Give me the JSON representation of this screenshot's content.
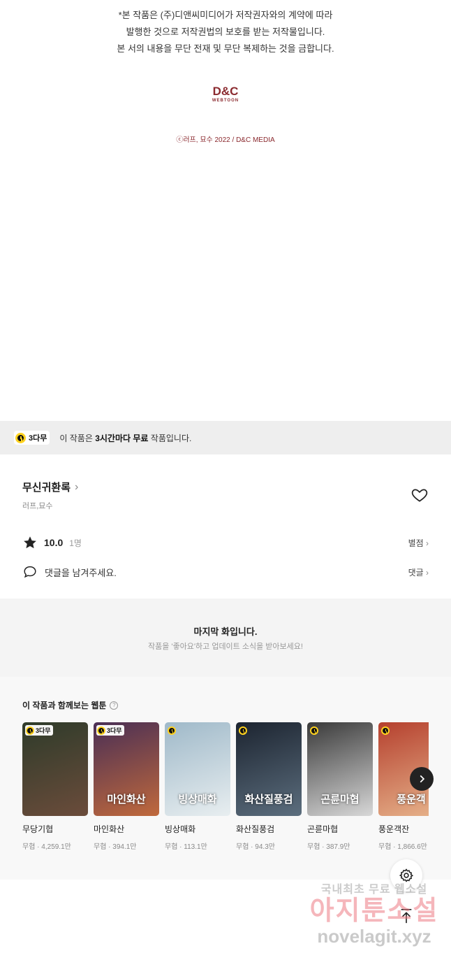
{
  "notice": {
    "line1": "*본 작품은 (주)디앤씨미디어가 저작권자와의 계약에 따라",
    "line2": "발행한 것으로 저작권법의 보호를 받는 저작물입니다.",
    "line3": "본 서의 내용을 무단 전재 및 무단 복제하는 것을 금합니다."
  },
  "logo": {
    "main": "D&C",
    "sub": "WEBTOON"
  },
  "copyright": "ⓒ러프, 묘수 2022 / D&C MEDIA",
  "free_bar": {
    "badge": "3다무",
    "text_prefix": "이 작품은 ",
    "text_bold": "3시간마다 무료",
    "text_suffix": " 작품입니다."
  },
  "work": {
    "title": "무신귀환록",
    "authors": "러프,묘수",
    "rating": "10.0",
    "rating_count": "1명",
    "rating_link": "별점",
    "comment_placeholder": "댓글을 남겨주세요.",
    "comment_link": "댓글"
  },
  "last_episode": {
    "title": "마지막 화입니다.",
    "subtitle": "작품을 '좋아요'하고 업데이트 소식을 받아보세요!"
  },
  "recommendations": {
    "heading": "이 작품과 함께보는 웹툰",
    "items": [
      {
        "name": "무당기협",
        "meta": "무협 · 4,259.1만",
        "badge": "3다무",
        "art": "",
        "color1": "#2e3b2a",
        "color2": "#6b4c3b"
      },
      {
        "name": "마인화산",
        "meta": "무협 · 394.1만",
        "badge": "3다무",
        "art": "마인화산",
        "color1": "#4a2f55",
        "color2": "#c0693c"
      },
      {
        "name": "빙상매화",
        "meta": "무협 · 113.1만",
        "badge": "",
        "art": "빙상매화",
        "color1": "#9fb9c9",
        "color2": "#e8eef0"
      },
      {
        "name": "화산질풍검",
        "meta": "무협 · 94.3만",
        "badge": "",
        "art": "화산질풍검",
        "color1": "#1c2430",
        "color2": "#5c6e7e"
      },
      {
        "name": "곤륜마협",
        "meta": "무협 · 387.9만",
        "badge": "",
        "art": "곤륜마협",
        "color1": "#3a3a3a",
        "color2": "#d8d8d8"
      },
      {
        "name": "풍운객잔",
        "meta": "무협 · 1,866.6만",
        "badge": "",
        "art": "풍운객",
        "color1": "#b5402e",
        "color2": "#e7b48c"
      }
    ]
  },
  "watermark": {
    "line1": "국내최초 무료 웹소설",
    "line2": "아지툰소설",
    "line3": "novelagit.xyz"
  },
  "colors": {
    "accent_yellow": "#ffd21f",
    "brand_red": "#8b2a2f"
  }
}
